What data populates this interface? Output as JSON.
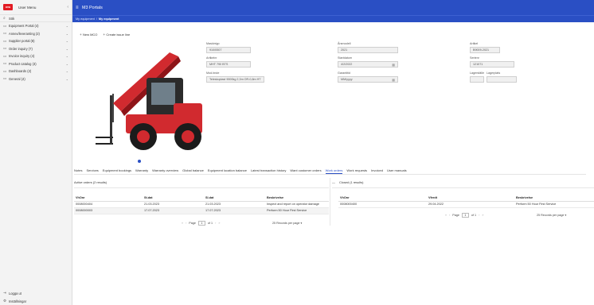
{
  "sidebar": {
    "header_label": "User Menu",
    "logo_text": "ovu",
    "search_label": "Sök",
    "items": [
      {
        "label": "Equipment Portal (4)"
      },
      {
        "label": "Annex/leveranting (2)"
      },
      {
        "label": "Supplier portal (8)"
      },
      {
        "label": "Order inquiry (7)"
      },
      {
        "label": "Invoice inquiry (4)"
      },
      {
        "label": "Product catalog (3)"
      },
      {
        "label": "Dashboards (2)"
      },
      {
        "label": "General (4)"
      }
    ],
    "bottom": [
      {
        "label": "Logga ut"
      },
      {
        "label": "Inställningar"
      }
    ]
  },
  "topbar": {
    "title": "M3 Portals"
  },
  "breadcrumb": {
    "parent": "My equipment",
    "separator": "/",
    "current": "My equipment"
  },
  "actions": {
    "new_label": "New MCO",
    "create_label": "Create issue line"
  },
  "details": {
    "maskintyp_label": "Maskintyp",
    "maskintyp_value": "910/0507",
    "artikelnr_label": "Artikelnr",
    "artikelnr_value": "MHT 790 BTS",
    "benamning_label": "Mod.bnde",
    "benamning_value": "Teleskoplast 9000kg 2,3m OR-0,8m HT",
    "arsmodell_label": "Årsmodell",
    "arsmodell_value": "2021",
    "startdatum_label": "Startdatum",
    "startdatum_value": "4/2/2022",
    "garanti_label": "Garantitid",
    "garanti_value": "MM/yyyy",
    "artikel2_label": "Artikel",
    "artikel2_value": "B9009-2021",
    "serienr_label": "Serienr",
    "serienr_value": "121071",
    "lagerstalle_label": "Lagerställe",
    "lagerplats_label": "Lagerplats"
  },
  "tabs": [
    {
      "label": "Notes"
    },
    {
      "label": "Services"
    },
    {
      "label": "Equipment bookings"
    },
    {
      "label": "Warranty"
    },
    {
      "label": "Warranty overview"
    },
    {
      "label": "Global balance"
    },
    {
      "label": "Equipment location balance"
    },
    {
      "label": "Latest transaction history"
    },
    {
      "label": "Want customer orders"
    },
    {
      "label": "Work orders"
    },
    {
      "label": "Work requests"
    },
    {
      "label": "Invoiced"
    },
    {
      "label": "User manuals"
    }
  ],
  "active_orders": {
    "title": "Active orders (2 results)",
    "columns": [
      "VhOnr",
      "St.dat",
      "Sl.dat",
      "Beskrivelse"
    ],
    "rows": [
      [
        "0008000404",
        "21.03.2023",
        "21.03.2023",
        "Inspect and report on operator damage"
      ],
      [
        "0008000003",
        "17.07.2023",
        "17.07.2023",
        "Perform 50 Hour First Service"
      ]
    ],
    "pager": {
      "first": "«",
      "prev": "‹",
      "page_label": "Page",
      "page": "1",
      "of_label": "of 1",
      "next": "›",
      "last": "»"
    },
    "rpp": "25 Records per page ▾"
  },
  "closed_orders": {
    "collapse": "—",
    "title": "Closed (1 results)",
    "columns": [
      "VhOnr",
      "Vferdt",
      "Beskrivelse"
    ],
    "rows": [
      [
        "0008000400",
        "29.04.2022",
        "Perform 50 Hour First Service"
      ]
    ],
    "pager": {
      "first": "«",
      "prev": "‹",
      "page_label": "Page",
      "page": "1",
      "of_label": "of 1",
      "next": "›",
      "last": "»"
    },
    "rpp": "25 Records per page ▾"
  },
  "colors": {
    "brand_blue": "#2a4fc4",
    "logo_red": "#e21b23"
  }
}
